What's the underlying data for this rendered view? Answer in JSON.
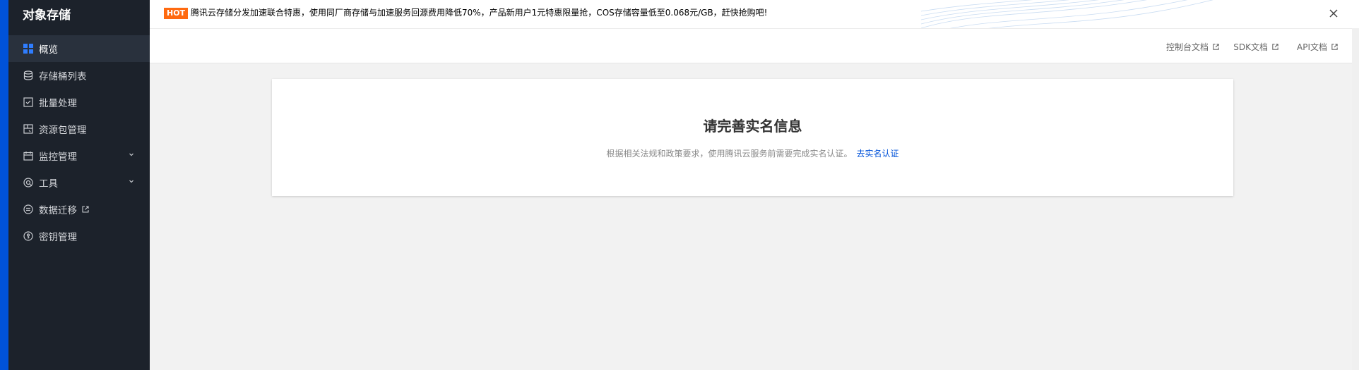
{
  "sidebar": {
    "brand": "对象存储",
    "items": [
      {
        "label": "概览",
        "icon": "grid-icon",
        "active": true
      },
      {
        "label": "存储桶列表",
        "icon": "bucket-icon"
      },
      {
        "label": "批量处理",
        "icon": "checkbox-icon"
      },
      {
        "label": "资源包管理",
        "icon": "package-icon"
      },
      {
        "label": "监控管理",
        "icon": "calendar-icon",
        "expandable": true
      },
      {
        "label": "工具",
        "icon": "tool-icon",
        "expandable": true
      },
      {
        "label": "数据迁移",
        "icon": "migrate-icon",
        "external": true
      },
      {
        "label": "密钥管理",
        "icon": "key-icon"
      }
    ]
  },
  "banner": {
    "badge": "HOT",
    "text": "腾讯云存储分发加速联合特惠，使用同厂商存储与加速服务回源费用降低70%，产品新用户1元特惠限量抢，COS存储容量低至0.068元/GB，赶快抢购吧!"
  },
  "doc_links": [
    {
      "label": "控制台文档"
    },
    {
      "label": "SDK文档"
    },
    {
      "label": "API文档"
    }
  ],
  "card": {
    "title": "请完善实名信息",
    "description": "根据相关法规和政策要求，使用腾讯云服务前需要完成实名认证。",
    "link": "去实名认证"
  },
  "colors": {
    "sidebar_bg": "#1c222b",
    "accent": "#0052d9",
    "hot": "#ff6a10"
  }
}
